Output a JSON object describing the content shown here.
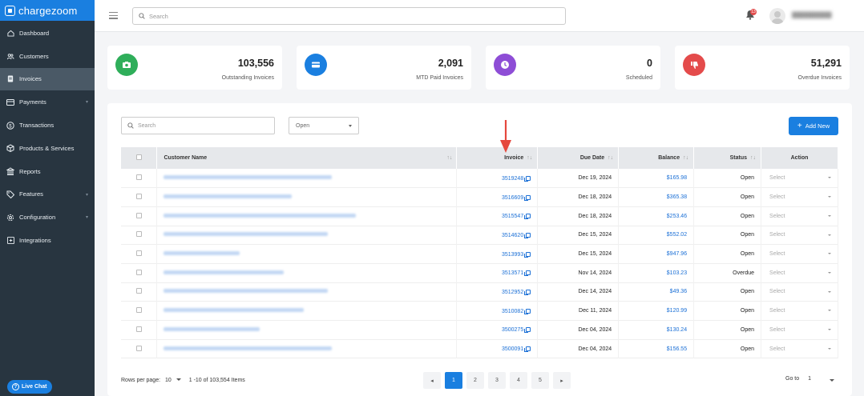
{
  "app": {
    "name": "chargezoom"
  },
  "sidebar": {
    "items": [
      {
        "label": "Dashboard"
      },
      {
        "label": "Customers"
      },
      {
        "label": "Invoices"
      },
      {
        "label": "Payments"
      },
      {
        "label": "Transactions"
      },
      {
        "label": "Products & Services"
      },
      {
        "label": "Reports"
      },
      {
        "label": "Features"
      },
      {
        "label": "Configuration"
      },
      {
        "label": "Integrations"
      }
    ],
    "live_chat": "Live Chat"
  },
  "topbar": {
    "search_placeholder": "Search",
    "notification_count": "13"
  },
  "stats": [
    {
      "value": "103,556",
      "label": "Outstanding Invoices",
      "color": "#2fae5a"
    },
    {
      "value": "2,091",
      "label": "MTD Paid Invoices",
      "color": "#1a7fe0"
    },
    {
      "value": "0",
      "label": "Scheduled",
      "color": "#8e4dd6"
    },
    {
      "value": "51,291",
      "label": "Overdue Invoices",
      "color": "#e44b4b"
    }
  ],
  "filters": {
    "search_placeholder": "Search",
    "status": "Open",
    "add_new": "Add New"
  },
  "table": {
    "headers": {
      "customer": "Customer Name",
      "invoice": "Invoice",
      "due_date": "Due Date",
      "balance": "Balance",
      "status": "Status",
      "action": "Action"
    },
    "rows": [
      {
        "invoice": "3519248",
        "due": "Dec 19, 2024",
        "balance": "$165.98",
        "status": "Open",
        "action": "Select"
      },
      {
        "invoice": "3516609",
        "due": "Dec 18, 2024",
        "balance": "$365.38",
        "status": "Open",
        "action": "Select"
      },
      {
        "invoice": "3515547",
        "due": "Dec 18, 2024",
        "balance": "$253.46",
        "status": "Open",
        "action": "Select"
      },
      {
        "invoice": "3514620",
        "due": "Dec 15, 2024",
        "balance": "$552.02",
        "status": "Open",
        "action": "Select"
      },
      {
        "invoice": "3513993",
        "due": "Dec 15, 2024",
        "balance": "$947.96",
        "status": "Open",
        "action": "Select"
      },
      {
        "invoice": "3513571",
        "due": "Nov 14, 2024",
        "balance": "$103.23",
        "status": "Overdue",
        "action": "Select"
      },
      {
        "invoice": "3512952",
        "due": "Dec 14, 2024",
        "balance": "$49.36",
        "status": "Open",
        "action": "Select"
      },
      {
        "invoice": "3510082",
        "due": "Dec 11, 2024",
        "balance": "$120.99",
        "status": "Open",
        "action": "Select"
      },
      {
        "invoice": "3500275",
        "due": "Dec 04, 2024",
        "balance": "$130.24",
        "status": "Open",
        "action": "Select"
      },
      {
        "invoice": "3500091",
        "due": "Dec 04, 2024",
        "balance": "$156.55",
        "status": "Open",
        "action": "Select"
      }
    ]
  },
  "pagination": {
    "rows_label": "Rows per page:",
    "rows_value": "10",
    "range": "1 -10 of 103,554  Items",
    "pages": [
      "1",
      "2",
      "3",
      "4",
      "5"
    ],
    "prev": "◂",
    "next": "▸",
    "goto_label": "Go to",
    "goto_value": "1"
  }
}
